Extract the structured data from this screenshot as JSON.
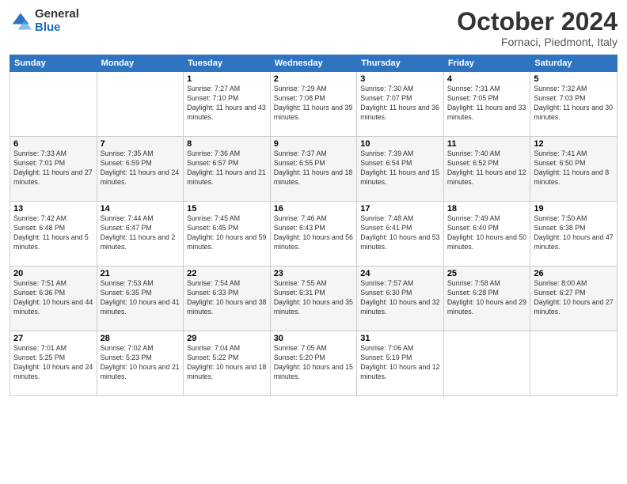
{
  "header": {
    "logo_general": "General",
    "logo_blue": "Blue",
    "month_title": "October 2024",
    "location": "Fornaci, Piedmont, Italy"
  },
  "weekdays": [
    "Sunday",
    "Monday",
    "Tuesday",
    "Wednesday",
    "Thursday",
    "Friday",
    "Saturday"
  ],
  "rows": [
    [
      {
        "day": "",
        "info": ""
      },
      {
        "day": "",
        "info": ""
      },
      {
        "day": "1",
        "info": "Sunrise: 7:27 AM\nSunset: 7:10 PM\nDaylight: 11 hours and 43 minutes."
      },
      {
        "day": "2",
        "info": "Sunrise: 7:29 AM\nSunset: 7:08 PM\nDaylight: 11 hours and 39 minutes."
      },
      {
        "day": "3",
        "info": "Sunrise: 7:30 AM\nSunset: 7:07 PM\nDaylight: 11 hours and 36 minutes."
      },
      {
        "day": "4",
        "info": "Sunrise: 7:31 AM\nSunset: 7:05 PM\nDaylight: 11 hours and 33 minutes."
      },
      {
        "day": "5",
        "info": "Sunrise: 7:32 AM\nSunset: 7:03 PM\nDaylight: 11 hours and 30 minutes."
      }
    ],
    [
      {
        "day": "6",
        "info": "Sunrise: 7:33 AM\nSunset: 7:01 PM\nDaylight: 11 hours and 27 minutes."
      },
      {
        "day": "7",
        "info": "Sunrise: 7:35 AM\nSunset: 6:59 PM\nDaylight: 11 hours and 24 minutes."
      },
      {
        "day": "8",
        "info": "Sunrise: 7:36 AM\nSunset: 6:57 PM\nDaylight: 11 hours and 21 minutes."
      },
      {
        "day": "9",
        "info": "Sunrise: 7:37 AM\nSunset: 6:55 PM\nDaylight: 11 hours and 18 minutes."
      },
      {
        "day": "10",
        "info": "Sunrise: 7:39 AM\nSunset: 6:54 PM\nDaylight: 11 hours and 15 minutes."
      },
      {
        "day": "11",
        "info": "Sunrise: 7:40 AM\nSunset: 6:52 PM\nDaylight: 11 hours and 12 minutes."
      },
      {
        "day": "12",
        "info": "Sunrise: 7:41 AM\nSunset: 6:50 PM\nDaylight: 11 hours and 8 minutes."
      }
    ],
    [
      {
        "day": "13",
        "info": "Sunrise: 7:42 AM\nSunset: 6:48 PM\nDaylight: 11 hours and 5 minutes."
      },
      {
        "day": "14",
        "info": "Sunrise: 7:44 AM\nSunset: 6:47 PM\nDaylight: 11 hours and 2 minutes."
      },
      {
        "day": "15",
        "info": "Sunrise: 7:45 AM\nSunset: 6:45 PM\nDaylight: 10 hours and 59 minutes."
      },
      {
        "day": "16",
        "info": "Sunrise: 7:46 AM\nSunset: 6:43 PM\nDaylight: 10 hours and 56 minutes."
      },
      {
        "day": "17",
        "info": "Sunrise: 7:48 AM\nSunset: 6:41 PM\nDaylight: 10 hours and 53 minutes."
      },
      {
        "day": "18",
        "info": "Sunrise: 7:49 AM\nSunset: 6:40 PM\nDaylight: 10 hours and 50 minutes."
      },
      {
        "day": "19",
        "info": "Sunrise: 7:50 AM\nSunset: 6:38 PM\nDaylight: 10 hours and 47 minutes."
      }
    ],
    [
      {
        "day": "20",
        "info": "Sunrise: 7:51 AM\nSunset: 6:36 PM\nDaylight: 10 hours and 44 minutes."
      },
      {
        "day": "21",
        "info": "Sunrise: 7:53 AM\nSunset: 6:35 PM\nDaylight: 10 hours and 41 minutes."
      },
      {
        "day": "22",
        "info": "Sunrise: 7:54 AM\nSunset: 6:33 PM\nDaylight: 10 hours and 38 minutes."
      },
      {
        "day": "23",
        "info": "Sunrise: 7:55 AM\nSunset: 6:31 PM\nDaylight: 10 hours and 35 minutes."
      },
      {
        "day": "24",
        "info": "Sunrise: 7:57 AM\nSunset: 6:30 PM\nDaylight: 10 hours and 32 minutes."
      },
      {
        "day": "25",
        "info": "Sunrise: 7:58 AM\nSunset: 6:28 PM\nDaylight: 10 hours and 29 minutes."
      },
      {
        "day": "26",
        "info": "Sunrise: 8:00 AM\nSunset: 6:27 PM\nDaylight: 10 hours and 27 minutes."
      }
    ],
    [
      {
        "day": "27",
        "info": "Sunrise: 7:01 AM\nSunset: 5:25 PM\nDaylight: 10 hours and 24 minutes."
      },
      {
        "day": "28",
        "info": "Sunrise: 7:02 AM\nSunset: 5:23 PM\nDaylight: 10 hours and 21 minutes."
      },
      {
        "day": "29",
        "info": "Sunrise: 7:04 AM\nSunset: 5:22 PM\nDaylight: 10 hours and 18 minutes."
      },
      {
        "day": "30",
        "info": "Sunrise: 7:05 AM\nSunset: 5:20 PM\nDaylight: 10 hours and 15 minutes."
      },
      {
        "day": "31",
        "info": "Sunrise: 7:06 AM\nSunset: 5:19 PM\nDaylight: 10 hours and 12 minutes."
      },
      {
        "day": "",
        "info": ""
      },
      {
        "day": "",
        "info": ""
      }
    ]
  ]
}
